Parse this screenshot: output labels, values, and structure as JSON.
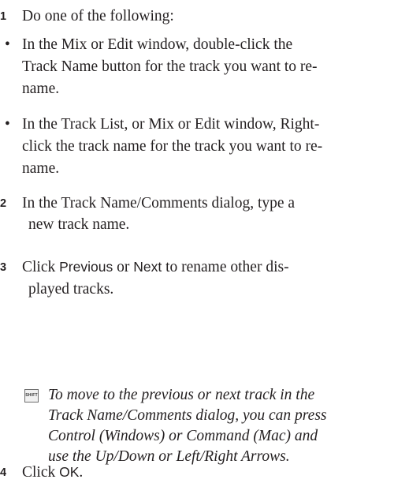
{
  "steps": [
    {
      "number": "1",
      "text": "Do one of the following:",
      "bullets": [
        {
          "lines": [
            "In the Mix or Edit window, double-click the",
            "Track Name button for the track you want to re-",
            "name."
          ]
        },
        {
          "lines": [
            "In the Track List, or Mix or Edit window, Right-",
            "click the track name for the track you want to re-",
            "name."
          ]
        }
      ]
    },
    {
      "number": "2",
      "lines": [
        "In the Track Name/Comments dialog, type a",
        "new track name."
      ]
    },
    {
      "number": "3",
      "line1": {
        "pre": "Click ",
        "ui1": "Previous",
        "mid": " or ",
        "ui2": "Next",
        "post": " to rename other dis-"
      },
      "line2": "played tracks."
    },
    {
      "number": "4",
      "line1": {
        "pre": "Click ",
        "ui": "OK",
        "post": "."
      }
    }
  ],
  "bullet_glyph": "•",
  "tip": {
    "icon": "shift-key-icon",
    "icon_label": "SHIFT",
    "lines": [
      "To move to the previous or next track in the",
      "Track Name/Comments dialog, you can press",
      "Control (Windows) or Command (Mac) and",
      "use the Up/Down or Left/Right Arrows."
    ]
  }
}
